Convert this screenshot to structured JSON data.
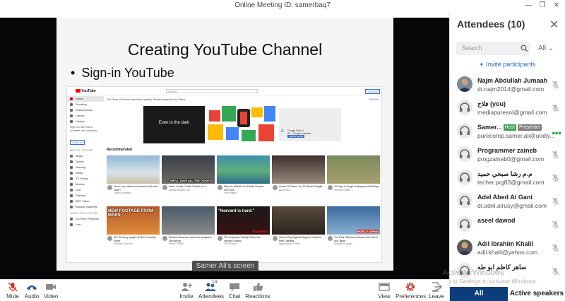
{
  "window": {
    "title": "Online Meeting ID: samerbaq7",
    "minimize": "—",
    "maximize": "❐",
    "close": "✕"
  },
  "stage": {
    "slide_title": "Creating YouTube Channel",
    "slide_bullet": "Sign-in YouTube",
    "screen_share_label": "Samer Ali's screen"
  },
  "youtube": {
    "logo": "YouTube",
    "search_placeholder": "Search",
    "signin": "SIGN IN",
    "banner": "Our Terms of Service have been updated. Please review the new Terms.",
    "banner_link": "REVIEW",
    "sidebar": {
      "items": [
        "Home",
        "Trending",
        "Subscriptions",
        "Library",
        "History"
      ],
      "note": "Sign in to like videos, comment, and subscribe.",
      "signin": "SIGN IN",
      "best_header": "BEST OF YOUTUBE",
      "best_items": [
        "Music",
        "Sports",
        "Gaming",
        "News",
        "TV Shows",
        "Movies",
        "Live",
        "Fashion",
        "360° Video"
      ],
      "more_items": [
        "Browse channels"
      ],
      "more_header": "MORE FROM YOUTUBE",
      "more2": [
        "YouTube Premium",
        "Live"
      ]
    },
    "ad": {
      "video_text": "Even in the dark",
      "product": "Google Pixel 4",
      "sub": "Ad · Google Australia",
      "button": "LEARN MORE"
    },
    "recommended_label": "Recommended",
    "videos": [
      {
        "title": "How Long it takes for Arrows to fall back down?",
        "channel": "Flight Academy",
        "overlay": "",
        "tag": ""
      },
      {
        "title": "Adam Levine Pranks Drivers in LA",
        "channel": "Jimmy Kimmel Live",
        "overlay": "",
        "tag": "WE'LL TAKE ALL THE TICKETS"
      },
      {
        "title": "Why the Atlantic and Pacific Oceans Don't Mix",
        "channel": "Life Noggin",
        "overlay": "",
        "tag": ""
      },
      {
        "title": "Aussie TikTokers Try 10 Minute Straight",
        "channel": "BuzzFeed",
        "overlay": "",
        "tag": ""
      },
      {
        "title": "10 Days in Jungle Underground Building",
        "channel": "Primitive Skills",
        "overlay": "",
        "tag": ""
      },
      {
        "title": "The Running Images of Mars Curiosity Rover",
        "channel": "Science Channel",
        "overlay": "NEW FOOTAGE FROM MARS",
        "tag": ""
      },
      {
        "title": "Richard Hammond takes his daughters off-roading",
        "channel": "DRIVETRIBE",
        "overlay": "",
        "tag": ""
      },
      {
        "title": "The Unspoken Reality Behind the Harvard Legacy",
        "channel": "TEDx Talks",
        "overlay": "\"Harvard is hard.\"",
        "tag": "TEDxSHSID"
      },
      {
        "title": "How to Play Against Magnus Carlsen's Best Opening",
        "channel": "agadmator's Chess",
        "overlay": "",
        "tag": ""
      },
      {
        "title": "The Real Difference Between the World and Japan",
        "channel": "Abroad in Japan",
        "overlay": "",
        "tag": "WORLD  JAPAN"
      }
    ]
  },
  "attendees_panel": {
    "title": "Attendees (10)",
    "close": "✕",
    "search_placeholder": "Search",
    "filter": "All",
    "invite_label": "Invite participants",
    "attendees": [
      {
        "name": "Najm Abdullah Jumaah",
        "email": "dr.najm2014@gmail.com",
        "host": "",
        "presenter": ""
      },
      {
        "name": "فلاح (you)",
        "email": "mediapuresol@gmail.com",
        "host": "",
        "presenter": ""
      },
      {
        "name": "Samer...",
        "email": "purecomp.samer.ali@uodiy...",
        "host": "Host",
        "presenter": "Presenter"
      },
      {
        "name": "Programmer zaineb",
        "email": "progzaineb0@gmail.com",
        "host": "",
        "presenter": ""
      },
      {
        "name": "م.م رشا صبحي حميد",
        "email": "techer.prg83@gmail.com",
        "host": "",
        "presenter": ""
      },
      {
        "name": "Adel Abed Al Gani",
        "email": "dr.adel.alrusy@gmail.com",
        "host": "",
        "presenter": ""
      },
      {
        "name": "aseel dawod",
        "email": "",
        "host": "",
        "presenter": ""
      },
      {
        "name": "Adil Ibrahim Khalil",
        "email": "adil.khalil@yahoo.com",
        "host": "",
        "presenter": ""
      },
      {
        "name": "ساهر كاظم ابو طه",
        "email": "",
        "host": "",
        "presenter": ""
      }
    ],
    "tab_all": "All",
    "tab_active": "Active speakers"
  },
  "watermark": {
    "line1": "Activate Windows",
    "line2": "Go to Settings to activate Windows."
  },
  "toolbar": {
    "mute": "Mute",
    "audio": "Audio",
    "video": "Video",
    "invite": "Invite",
    "attendees": "Attendees",
    "attendees_count": "10",
    "chat": "Chat",
    "reactions": "Reactions",
    "view": "View",
    "preferences": "Preferences",
    "leave": "Leave"
  },
  "colors": {
    "accent": "#0b3c7c",
    "link": "#2168c8",
    "host": "#3f9c4c",
    "presenter": "#7b7b7b",
    "mute": "#d9352f"
  }
}
